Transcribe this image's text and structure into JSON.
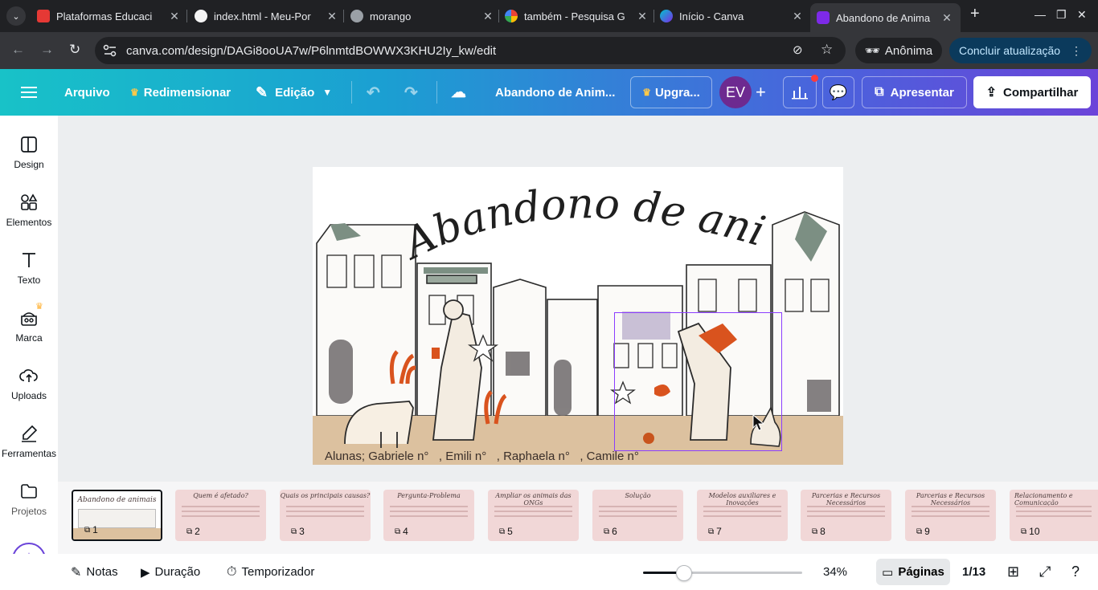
{
  "browser": {
    "tabs": [
      {
        "title": "Plataformas Educaci",
        "favicon_color": "#e53935",
        "active": false
      },
      {
        "title": "index.html - Meu-Por",
        "favicon_color": "#f5f5f5",
        "active": false
      },
      {
        "title": "morango",
        "favicon_color": "#9aa0a6",
        "active": false
      },
      {
        "title": "também - Pesquisa G",
        "favicon_color": "#4285f4",
        "active": false
      },
      {
        "title": "Início - Canva",
        "favicon_color": "#00c4cc",
        "active": false
      },
      {
        "title": "Abandono de Anima",
        "favicon_color": "#7d2ae8",
        "active": true
      }
    ],
    "url": "canva.com/design/DAGi8ooUA7w/P6lnmtdBOWWX3KHU2Iy_kw/edit",
    "profile_label": "Anônima",
    "update_label": "Concluir atualização"
  },
  "canva_header": {
    "file_label": "Arquivo",
    "resize_label": "Redimensionar",
    "edit_label": "Edição",
    "doc_title": "Abandono de Anim...",
    "upgrade_label": "Upgra...",
    "avatar_initials": "EV",
    "present_label": "Apresentar",
    "share_label": "Compartilhar"
  },
  "sidebar": {
    "items": [
      {
        "label": "Design",
        "icon": "design-icon"
      },
      {
        "label": "Elementos",
        "icon": "elements-icon"
      },
      {
        "label": "Texto",
        "icon": "text-icon"
      },
      {
        "label": "Marca",
        "icon": "brand-icon"
      },
      {
        "label": "Uploads",
        "icon": "upload-icon"
      },
      {
        "label": "Ferramentas",
        "icon": "tools-icon"
      },
      {
        "label": "Projetos",
        "icon": "folder-icon"
      }
    ]
  },
  "slide": {
    "title": "Abandono de  animais",
    "credits": "Alunas; Gabriele n°   , Emili n°   , Raphaela n°   , Camile n°"
  },
  "thumbnails": [
    {
      "num": "1",
      "title": "Abandono de animais"
    },
    {
      "num": "2",
      "title": "Quem é afetado?"
    },
    {
      "num": "3",
      "title": "Quais os principais causas?"
    },
    {
      "num": "4",
      "title": "Pergunta-Problema"
    },
    {
      "num": "5",
      "title": "Ampliar os animais das ONGs"
    },
    {
      "num": "6",
      "title": "Solução"
    },
    {
      "num": "7",
      "title": "Modelos auxiliares e Inovações"
    },
    {
      "num": "8",
      "title": "Parcerias e Recursos Necessários"
    },
    {
      "num": "9",
      "title": "Parcerias e Recursos Necessários"
    },
    {
      "num": "10",
      "title": "Relacionamento e Comunicação"
    }
  ],
  "bottom": {
    "notes_label": "Notas",
    "duration_label": "Duração",
    "timer_label": "Temporizador",
    "zoom": "34%",
    "zoom_fraction": 0.34,
    "pages_label": "Páginas",
    "page_counter": "1/13"
  },
  "colors": {
    "accent": "#8b3dff",
    "canva_teal": "#18c2c8",
    "ground": "#dcc19f"
  }
}
